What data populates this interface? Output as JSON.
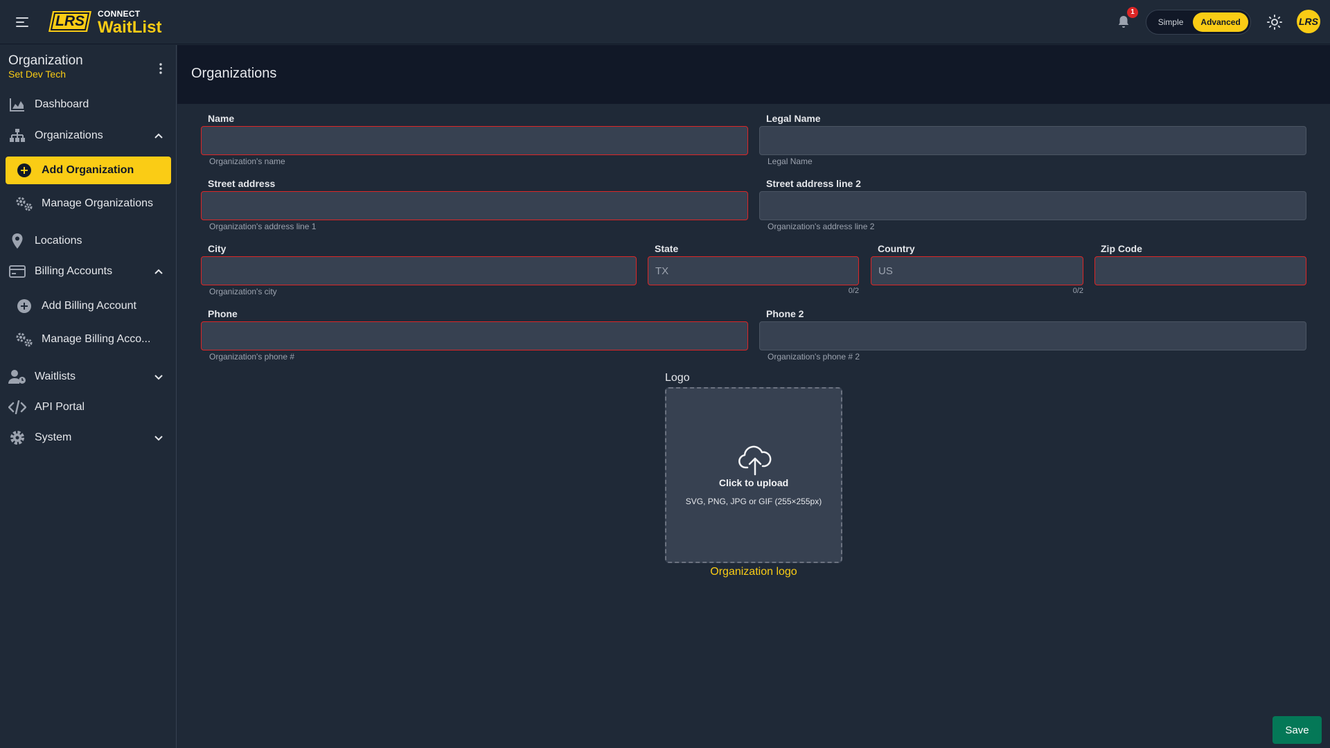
{
  "header": {
    "brand_small": "CONNECT",
    "brand_big": "WaitList",
    "logo_text": "LRS",
    "notification_count": "1",
    "mode_simple": "Simple",
    "mode_advanced": "Advanced",
    "avatar_text": "LRS"
  },
  "sidebar": {
    "org_title": "Organization",
    "org_subtitle": "Set Dev Tech",
    "items": {
      "dashboard": "Dashboard",
      "organizations": "Organizations",
      "add_organization": "Add Organization",
      "manage_organizations": "Manage Organizations",
      "locations": "Locations",
      "billing_accounts": "Billing Accounts",
      "add_billing_account": "Add Billing Account",
      "manage_billing_accounts": "Manage Billing Acco...",
      "waitlists": "Waitlists",
      "api_portal": "API Portal",
      "system": "System"
    }
  },
  "page": {
    "title": "Organizations"
  },
  "form": {
    "name": {
      "label": "Name",
      "hint": "Organization's name",
      "value": ""
    },
    "legal_name": {
      "label": "Legal Name",
      "hint": "Legal Name",
      "value": ""
    },
    "street": {
      "label": "Street address",
      "hint": "Organization's address line 1",
      "value": ""
    },
    "street2": {
      "label": "Street address line 2",
      "hint": "Organization's address line 2",
      "value": ""
    },
    "city": {
      "label": "City",
      "hint": "Organization's city",
      "value": ""
    },
    "state": {
      "label": "State",
      "placeholder": "TX",
      "counter": "0/2",
      "value": ""
    },
    "country": {
      "label": "Country",
      "placeholder": "US",
      "counter": "0/2",
      "value": ""
    },
    "zip": {
      "label": "Zip Code",
      "value": ""
    },
    "phone": {
      "label": "Phone",
      "hint": "Organization's phone #",
      "value": ""
    },
    "phone2": {
      "label": "Phone 2",
      "hint": "Organization's phone # 2",
      "value": ""
    }
  },
  "logo": {
    "label": "Logo",
    "upload_title": "Click to upload",
    "upload_formats": "SVG, PNG, JPG or GIF (255×255px)",
    "caption": "Organization logo"
  },
  "actions": {
    "save_label": "Save"
  },
  "colors": {
    "accent": "#facc15",
    "error": "#dc2626",
    "save": "#047857",
    "bg": "#1f2937",
    "header_bg": "#111827"
  }
}
